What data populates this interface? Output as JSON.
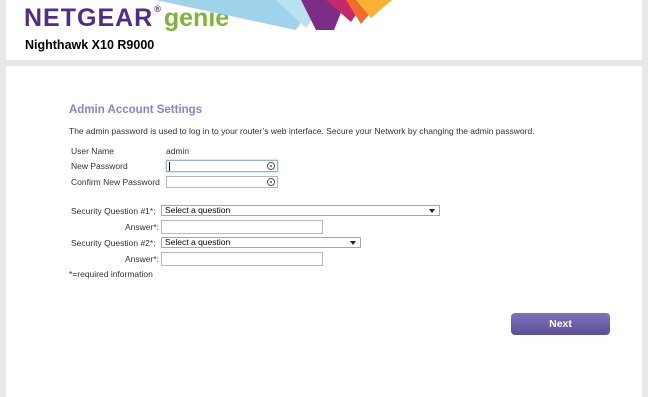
{
  "header": {
    "brand": "NETGEAR",
    "brand_mark": "®",
    "product": "genie",
    "product_mark": "®",
    "model": "Nighthawk X10 R9000"
  },
  "page": {
    "title": "Admin Account Settings",
    "description": "The admin password is used to log in to your router’s web interface. Secure your Network by changing the admin password."
  },
  "form": {
    "user_name_label": "User Name",
    "user_name_value": "admin",
    "new_password_label": "New Password",
    "confirm_password_label": "Confirm New Password",
    "q1_label": "Security Question #1*:",
    "q1_value": "Select a question",
    "answer1_label": "Answer*:",
    "q2_label": "Security Question #2*:",
    "q2_value": "Select a question",
    "answer2_label": "Answer*:",
    "required_note": "*=required information"
  },
  "actions": {
    "next_label": "Next"
  },
  "icons": {
    "password_toggle": "eye-icon",
    "dropdown": "chevron-down-icon"
  },
  "colors": {
    "brand_purple": "#4e2d8e",
    "genie_green": "#7db536",
    "title_purple": "#8b7fd6",
    "button": "#6a5fa8"
  }
}
